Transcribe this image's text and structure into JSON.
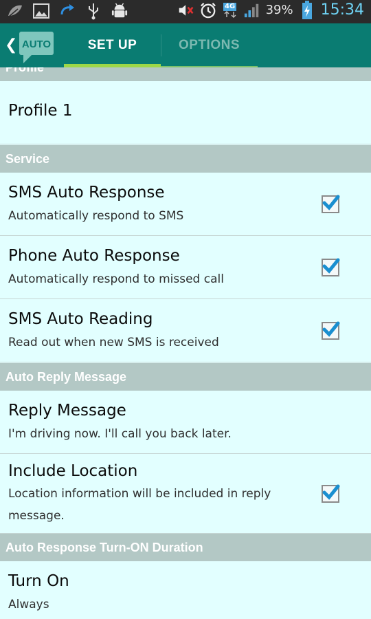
{
  "status_bar": {
    "left_icons": [
      "leaf-icon",
      "image-icon",
      "sync-icon",
      "usb-icon",
      "android-debug-icon"
    ],
    "right_icons": [
      "mute-icon",
      "alarm-icon",
      "4g-icon",
      "signal-icon",
      "battery-icon"
    ],
    "network": "4G",
    "battery_percent": "39%",
    "time": "15:34"
  },
  "action_bar": {
    "logo_text": "AUTO",
    "tabs": [
      {
        "label": "SET UP",
        "active": true
      },
      {
        "label": "OPTIONS",
        "active": false
      }
    ]
  },
  "content": {
    "partial_header": "Profile",
    "profile": {
      "title": "Profile 1"
    },
    "sections": [
      {
        "header": "Service",
        "items": [
          {
            "title": "SMS Auto Response",
            "summary": "Automatically respond to SMS",
            "checked": true
          },
          {
            "title": "Phone Auto Response",
            "summary": "Automatically respond to missed call",
            "checked": true
          },
          {
            "title": "SMS Auto Reading",
            "summary": "Read out when new SMS is received",
            "checked": true
          }
        ]
      },
      {
        "header": "Auto Reply Message",
        "items": [
          {
            "title": "Reply Message",
            "summary": "I'm driving now. I'll call you back later."
          },
          {
            "title": "Include Location",
            "summary": "Location information will be included in reply message.",
            "checked": true
          }
        ]
      },
      {
        "header": "Auto Response Turn-ON Duration",
        "items": [
          {
            "title": "Turn On",
            "summary": "Always"
          }
        ]
      }
    ]
  },
  "colors": {
    "action_bar": "#0a7c72",
    "tab_indicator": "#9ed848",
    "section_header": "#b3c8c5",
    "background": "#e2ffff",
    "checkmark": "#1a8fd0",
    "clock": "#6fd3f4"
  }
}
